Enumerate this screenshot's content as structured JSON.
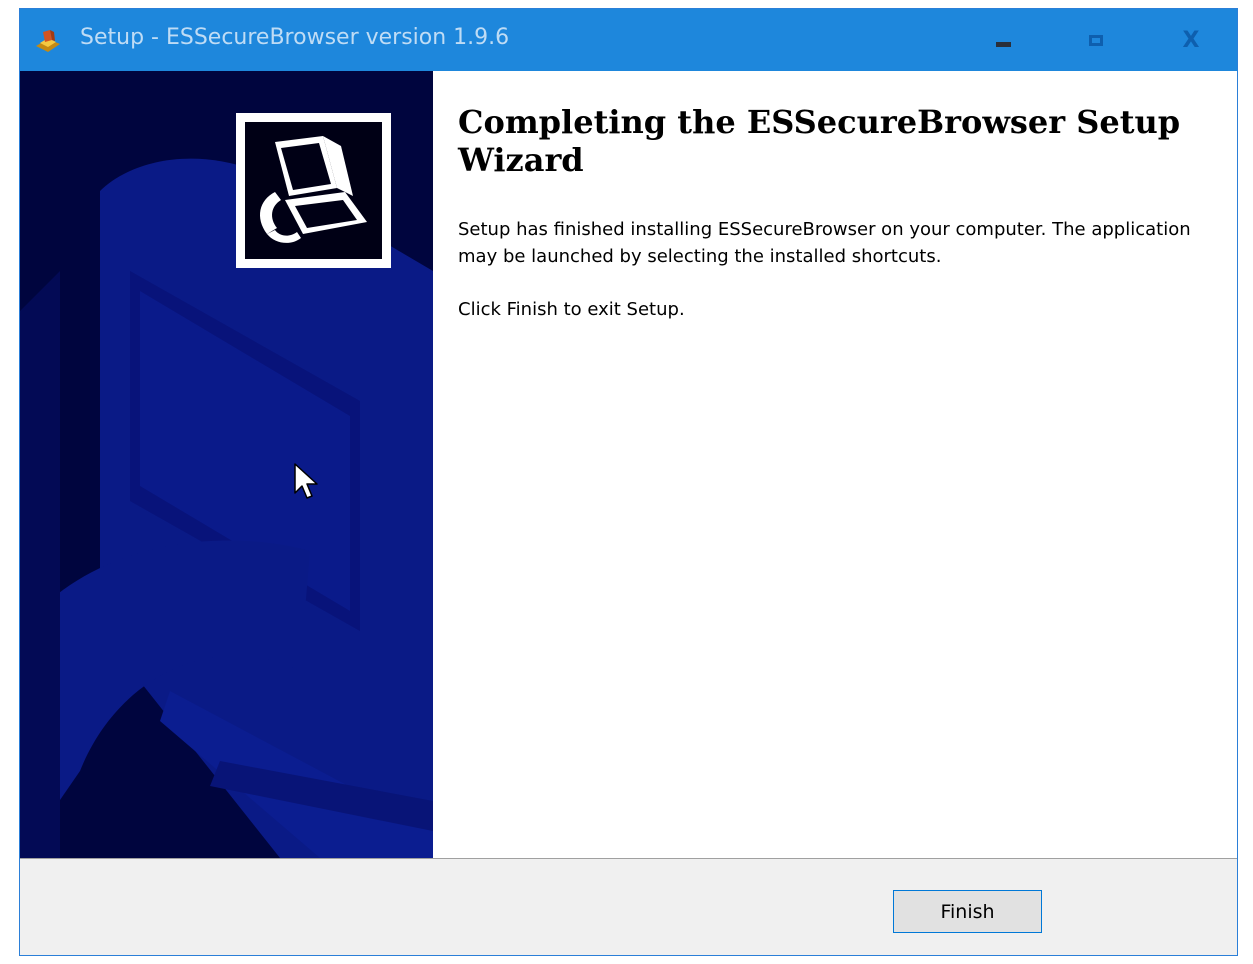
{
  "window": {
    "title": "Setup - ESSecureBrowser version 1.9.6",
    "titlebar_color": "#1e87dc",
    "controls": {
      "minimize_icon": "minimize-icon",
      "maximize_icon": "maximize-icon",
      "close_glyph": "X"
    }
  },
  "wizard": {
    "heading": "Completing the ESSecureBrowser Setup Wizard",
    "paragraph1": "Setup has finished installing ESSecureBrowser on your computer. The application may be launched by selecting the installed shortcuts.",
    "paragraph2": "Click Finish to exit Setup.",
    "side_panel_color": "#00053e",
    "side_logo_icon": "installer-computer-icon"
  },
  "footer": {
    "finish_label": "Finish"
  }
}
